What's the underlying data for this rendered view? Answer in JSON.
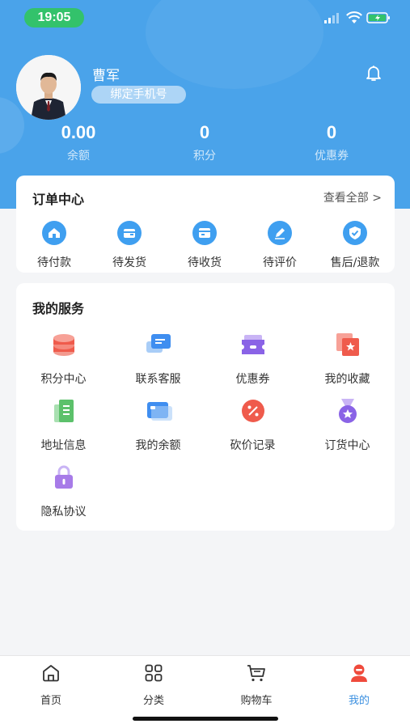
{
  "status_bar": {
    "time": "19:05"
  },
  "profile": {
    "name": "曹军",
    "bind_phone": "绑定手机号"
  },
  "stats": [
    {
      "value": "0.00",
      "label": "余额"
    },
    {
      "value": "0",
      "label": "积分"
    },
    {
      "value": "0",
      "label": "优惠券"
    }
  ],
  "orders": {
    "title": "订单中心",
    "view_all": "查看全部 >",
    "items": [
      {
        "label": "待付款",
        "icon": "house-icon"
      },
      {
        "label": "待发货",
        "icon": "wallet-icon"
      },
      {
        "label": "待收货",
        "icon": "package-icon"
      },
      {
        "label": "待评价",
        "icon": "pencil-icon"
      },
      {
        "label": "售后/退款",
        "icon": "shield-check-icon"
      }
    ]
  },
  "services": {
    "title": "我的服务",
    "items": [
      {
        "label": "积分中心",
        "icon": "coins-stack-icon",
        "color": "#ef5b4c"
      },
      {
        "label": "联系客服",
        "icon": "chat-bubbles-icon",
        "color": "#3f8ef0"
      },
      {
        "label": "优惠券",
        "icon": "ticket-icon",
        "color": "#8a63e6"
      },
      {
        "label": "我的收藏",
        "icon": "favorites-icon",
        "color": "#ef5b4c"
      },
      {
        "label": "地址信息",
        "icon": "document-icon",
        "color": "#5cc16b"
      },
      {
        "label": "我的余额",
        "icon": "card-icon",
        "color": "#3f8ef0"
      },
      {
        "label": "砍价记录",
        "icon": "discount-badge-icon",
        "color": "#ef5b4c"
      },
      {
        "label": "订货中心",
        "icon": "medal-icon",
        "color": "#8a63e6"
      },
      {
        "label": "隐私协议",
        "icon": "lock-icon",
        "color": "#a77be8"
      }
    ]
  },
  "tabbar": {
    "items": [
      {
        "label": "首页",
        "icon": "home-icon"
      },
      {
        "label": "分类",
        "icon": "grid-icon"
      },
      {
        "label": "购物车",
        "icon": "cart-icon"
      },
      {
        "label": "我的",
        "icon": "user-icon",
        "active": true
      }
    ]
  },
  "colors": {
    "primary": "#4aa3ea",
    "active_tab": "#3a8fe0",
    "status_pill": "#33c26b"
  }
}
